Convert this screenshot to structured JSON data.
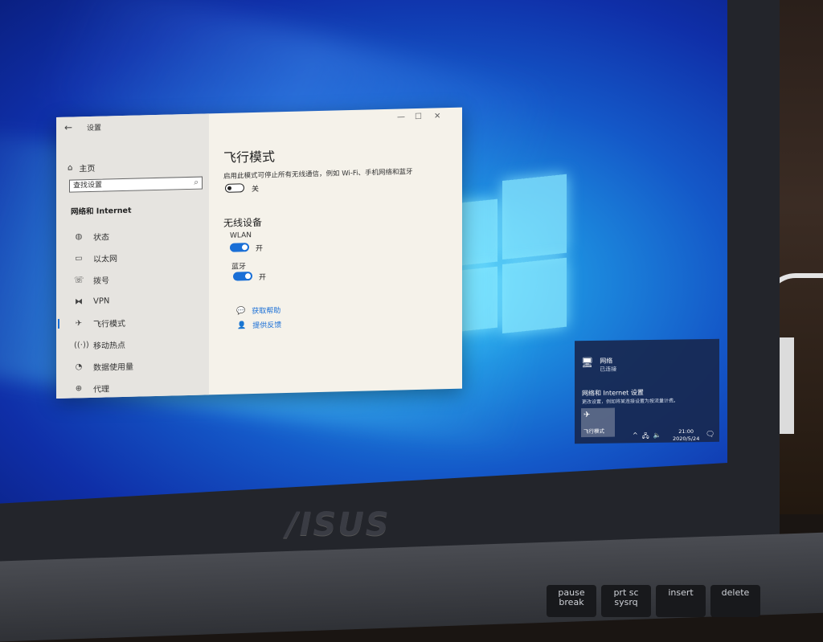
{
  "settings_window": {
    "title": "设置",
    "controls": {
      "minimize": "—",
      "maximize": "☐",
      "close": "✕"
    },
    "sidebar": {
      "home_label": "主页",
      "search_placeholder": "查找设置",
      "section_title": "网络和 Internet",
      "items": [
        {
          "label": "状态",
          "icon": "globe-icon"
        },
        {
          "label": "以太网",
          "icon": "ethernet-icon"
        },
        {
          "label": "拨号",
          "icon": "dialup-icon"
        },
        {
          "label": "VPN",
          "icon": "vpn-icon"
        },
        {
          "label": "飞行模式",
          "icon": "airplane-icon",
          "active": true
        },
        {
          "label": "移动热点",
          "icon": "hotspot-icon"
        },
        {
          "label": "数据使用量",
          "icon": "data-usage-icon"
        },
        {
          "label": "代理",
          "icon": "proxy-icon"
        }
      ]
    },
    "main": {
      "heading": "飞行模式",
      "description": "启用此模式可停止所有无线通信，例如 Wi-Fi、手机网络和蓝牙",
      "airplane_toggle": {
        "state": "关",
        "on": false
      },
      "wireless_heading": "无线设备",
      "wlan": {
        "label": "WLAN",
        "state": "开",
        "on": true
      },
      "bluetooth": {
        "label": "蓝牙",
        "state": "开",
        "on": true
      },
      "links": {
        "help": "获取帮助",
        "feedback": "提供反馈"
      }
    }
  },
  "network_flyout": {
    "network_name": "网络",
    "network_status": "已连接",
    "settings_title": "网络和 Internet 设置",
    "settings_desc": "更改设置，例如将某连接设置为按流量计费。",
    "tile_label": "飞行模式"
  },
  "taskbar": {
    "time": "21:00",
    "date": "2020/5/24"
  },
  "laptop": {
    "brand": "/ISUS",
    "keys": [
      {
        "line1": "pause",
        "line2": "break"
      },
      {
        "line1": "prt sc",
        "line2": "sysrq"
      },
      {
        "line1": "insert",
        "line2": ""
      },
      {
        "line1": "delete",
        "line2": ""
      }
    ]
  },
  "colors": {
    "accent": "#1a6fd6",
    "desktop": "#1458c8"
  }
}
